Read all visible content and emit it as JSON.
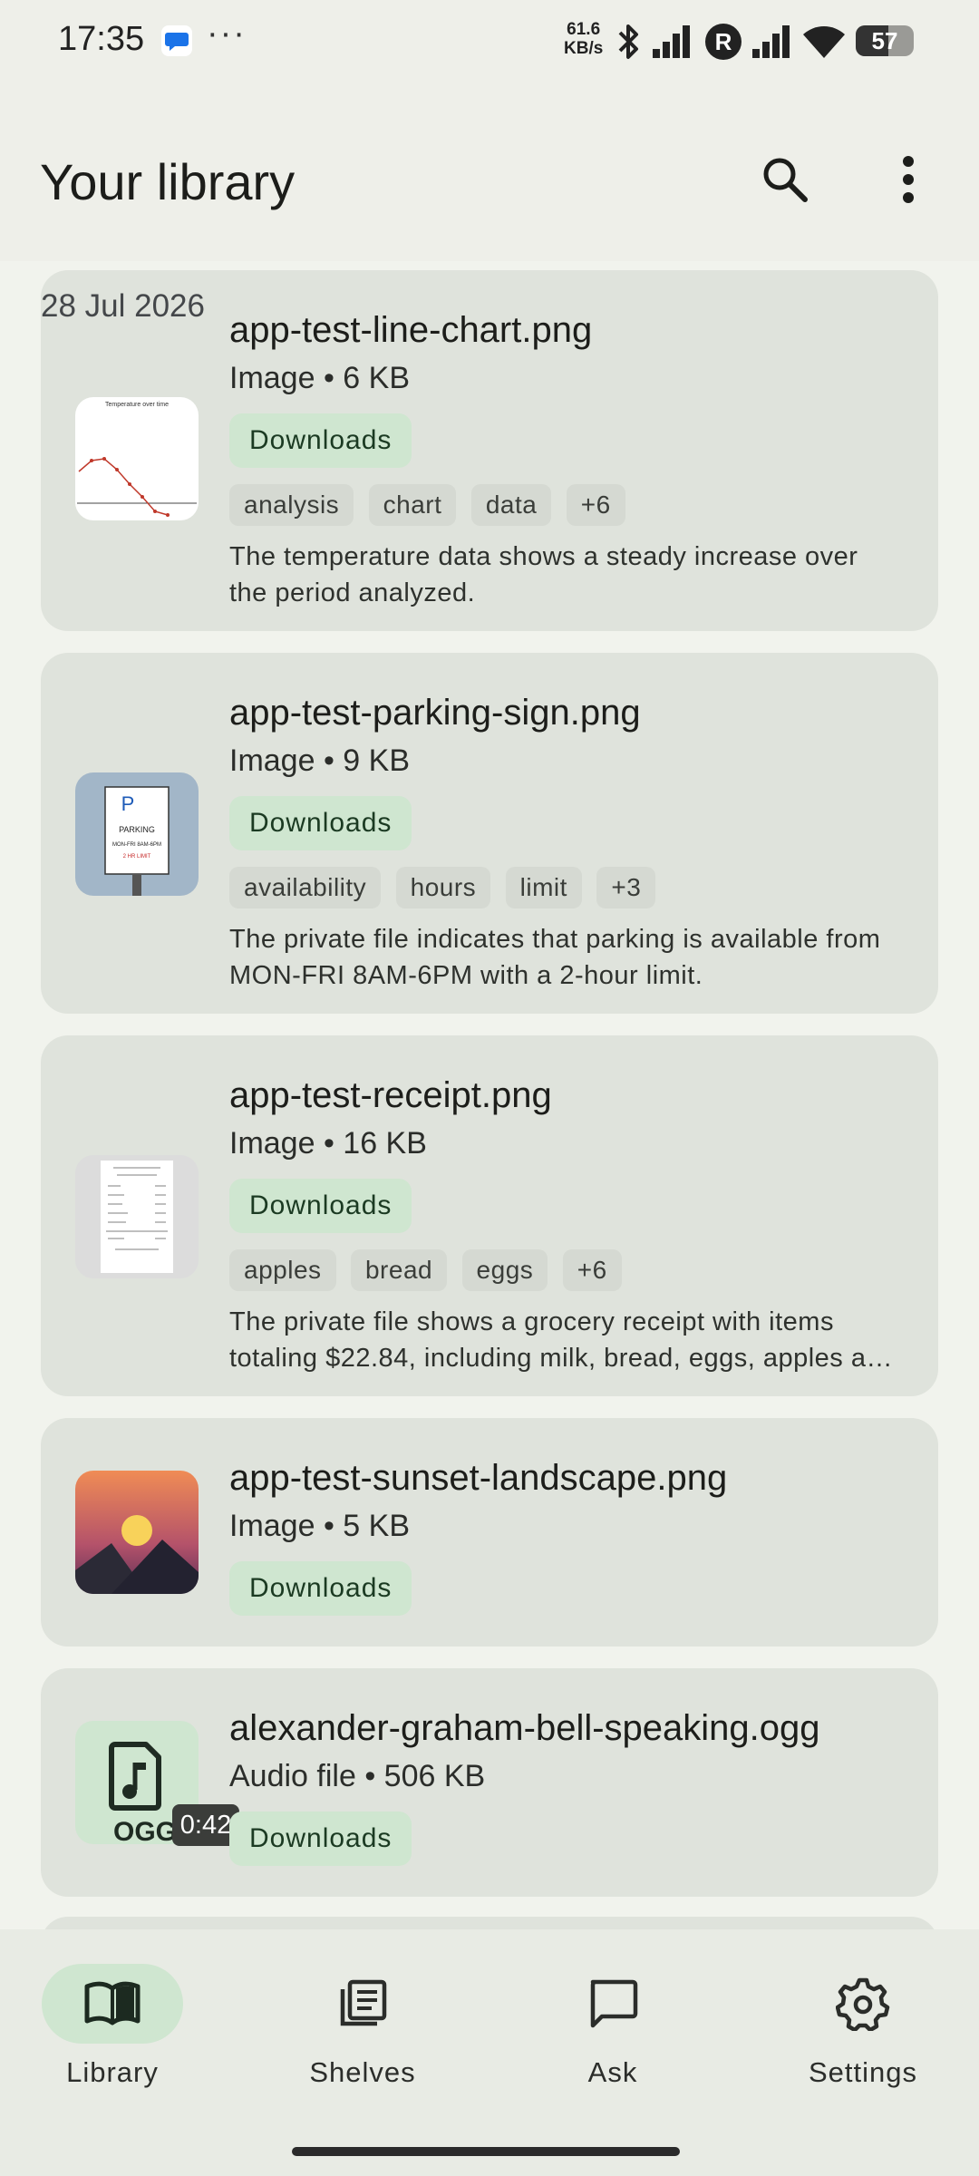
{
  "status_bar": {
    "time": "17:35",
    "dots": "···",
    "speed_value": "61.6",
    "speed_unit": "KB/s",
    "battery": "57"
  },
  "app_bar": {
    "title": "Your library",
    "search_icon": "search-icon",
    "menu_icon": "more-vert-icon"
  },
  "list": {
    "date_header": "28 Jul 2026",
    "items": [
      {
        "name": "app-test-line-chart.png",
        "meta": "Image • 6 KB",
        "location": "Downloads",
        "tags": [
          "analysis",
          "chart",
          "data",
          "+6"
        ],
        "description": "The temperature data shows a steady increase over the period analyzed.",
        "thumb_title": "Temperature over time"
      },
      {
        "name": "app-test-parking-sign.png",
        "meta": "Image • 9 KB",
        "location": "Downloads",
        "tags": [
          "availability",
          "hours",
          "limit",
          "+3"
        ],
        "description": "The private file indicates that parking is available from MON-FRI 8AM-6PM with a 2-hour limit.",
        "thumb_p": "P",
        "thumb_parking": "PARKING",
        "thumb_hours": "MON-FRI 8AM-6PM",
        "thumb_limit": "2 HR LIMIT"
      },
      {
        "name": "app-test-receipt.png",
        "meta": "Image • 16 KB",
        "location": "Downloads",
        "tags": [
          "apples",
          "bread",
          "eggs",
          "+6"
        ],
        "description": "The private file shows a grocery receipt with items totaling $22.84, including milk, bread, eggs, apples and more."
      },
      {
        "name": "app-test-sunset-landscape.png",
        "meta": "Image • 5 KB",
        "location": "Downloads"
      },
      {
        "name": "alexander-graham-bell-speaking.ogg",
        "meta": "Audio file • 506 KB",
        "location": "Downloads",
        "thumb_ext": "OGG",
        "duration": "0:42"
      }
    ]
  },
  "bottom_nav": {
    "items": [
      {
        "label": "Library",
        "icon": "book-open-icon",
        "active": true
      },
      {
        "label": "Shelves",
        "icon": "shelves-icon",
        "active": false
      },
      {
        "label": "Ask",
        "icon": "chat-bubble-icon",
        "active": false
      },
      {
        "label": "Settings",
        "icon": "gear-icon",
        "active": false
      }
    ]
  },
  "colors": {
    "background": "#eeefe9",
    "card": "#dfe3dc",
    "chip": "#cfe6d0",
    "active_nav": "#cfe6d0"
  }
}
